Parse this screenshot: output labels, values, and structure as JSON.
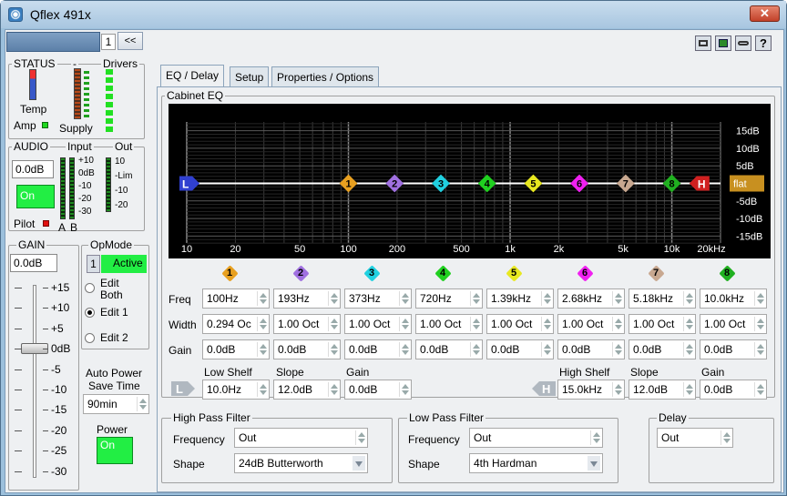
{
  "window": {
    "title": "Qflex 491x",
    "close": "✕"
  },
  "top": {
    "channel": "1",
    "collapse": "<<"
  },
  "status": {
    "title": "STATUS",
    "dash": "-",
    "drivers": "Drivers",
    "temp": "Temp",
    "amp": "Amp",
    "supply": "Supply"
  },
  "audio": {
    "title": "AUDIO",
    "input": "Input",
    "out": "Out",
    "gain_value": "0.0dB",
    "on": "On",
    "pilot": "Pilot",
    "a": "A",
    "b": "B",
    "in_ticks": [
      "+10",
      "0dB",
      "-10",
      "-20",
      "-30"
    ],
    "out_ticks": [
      "10",
      "-Lim",
      "-10",
      "-20"
    ]
  },
  "gain": {
    "title": "GAIN",
    "value": "0.0dB",
    "ticks": [
      "+15",
      "+10",
      "+5",
      "0dB",
      "-5",
      "-10",
      "-15",
      "-20",
      "-25",
      "-30"
    ],
    "level_db": 0
  },
  "opmode": {
    "title": "OpMode",
    "num": "1",
    "active": "Active",
    "options": [
      "Edit Both",
      "Edit 1",
      "Edit 2"
    ],
    "selected": "Edit 1"
  },
  "autopower": {
    "label1": "Auto Power",
    "label2": "Save Time",
    "value": "90min",
    "power": "Power",
    "on": "On"
  },
  "tabs": [
    "EQ / Delay",
    "Setup",
    "Properties / Options"
  ],
  "eq": {
    "title": "Cabinet EQ",
    "x_ticks": [
      "10",
      "20",
      "50",
      "100",
      "200",
      "500",
      "1k",
      "2k",
      "5k",
      "10k",
      "20kHz"
    ],
    "y_ticks": [
      "15dB",
      "10dB",
      "5dB",
      "0dB",
      "-5dB",
      "-10dB",
      "-15dB"
    ],
    "flat": "flat",
    "low_marker": "L",
    "high_marker": "H",
    "bands": [
      {
        "n": "1",
        "color": "#e8a020",
        "freq": "100Hz",
        "width": "0.294 Oc",
        "gain": "0.0dB",
        "hz": 100
      },
      {
        "n": "2",
        "color": "#a070e0",
        "freq": "193Hz",
        "width": "1.00 Oct",
        "gain": "0.0dB",
        "hz": 193
      },
      {
        "n": "3",
        "color": "#20d0e0",
        "freq": "373Hz",
        "width": "1.00 Oct",
        "gain": "0.0dB",
        "hz": 373
      },
      {
        "n": "4",
        "color": "#20d020",
        "freq": "720Hz",
        "width": "1.00 Oct",
        "gain": "0.0dB",
        "hz": 720
      },
      {
        "n": "5",
        "color": "#e8e820",
        "freq": "1.39kHz",
        "width": "1.00 Oct",
        "gain": "0.0dB",
        "hz": 1390
      },
      {
        "n": "6",
        "color": "#f020f0",
        "freq": "2.68kHz",
        "width": "1.00 Oct",
        "gain": "0.0dB",
        "hz": 2680
      },
      {
        "n": "7",
        "color": "#c8a890",
        "freq": "5.18kHz",
        "width": "1.00 Oct",
        "gain": "0.0dB",
        "hz": 5180
      },
      {
        "n": "8",
        "color": "#20b020",
        "freq": "10.0kHz",
        "width": "1.00 Oct",
        "gain": "0.0dB",
        "hz": 10000
      }
    ],
    "row_labels": [
      "Freq",
      "Width",
      "Gain"
    ],
    "low_shelf": {
      "label": "Low Shelf",
      "slope_label": "Slope",
      "gain_label": "Gain",
      "freq": "10.0Hz",
      "slope": "12.0dB",
      "gain": "0.0dB"
    },
    "high_shelf": {
      "label": "High Shelf",
      "slope_label": "Slope",
      "gain_label": "Gain",
      "freq": "15.0kHz",
      "slope": "12.0dB",
      "gain": "0.0dB"
    }
  },
  "hpf": {
    "title": "High Pass Filter",
    "freq_label": "Frequency",
    "freq": "Out",
    "shape_label": "Shape",
    "shape": "24dB Butterworth"
  },
  "lpf": {
    "title": "Low Pass Filter",
    "freq_label": "Frequency",
    "freq": "Out",
    "shape_label": "Shape",
    "shape": "4th Hardman"
  },
  "delay": {
    "title": "Delay",
    "value": "Out"
  }
}
